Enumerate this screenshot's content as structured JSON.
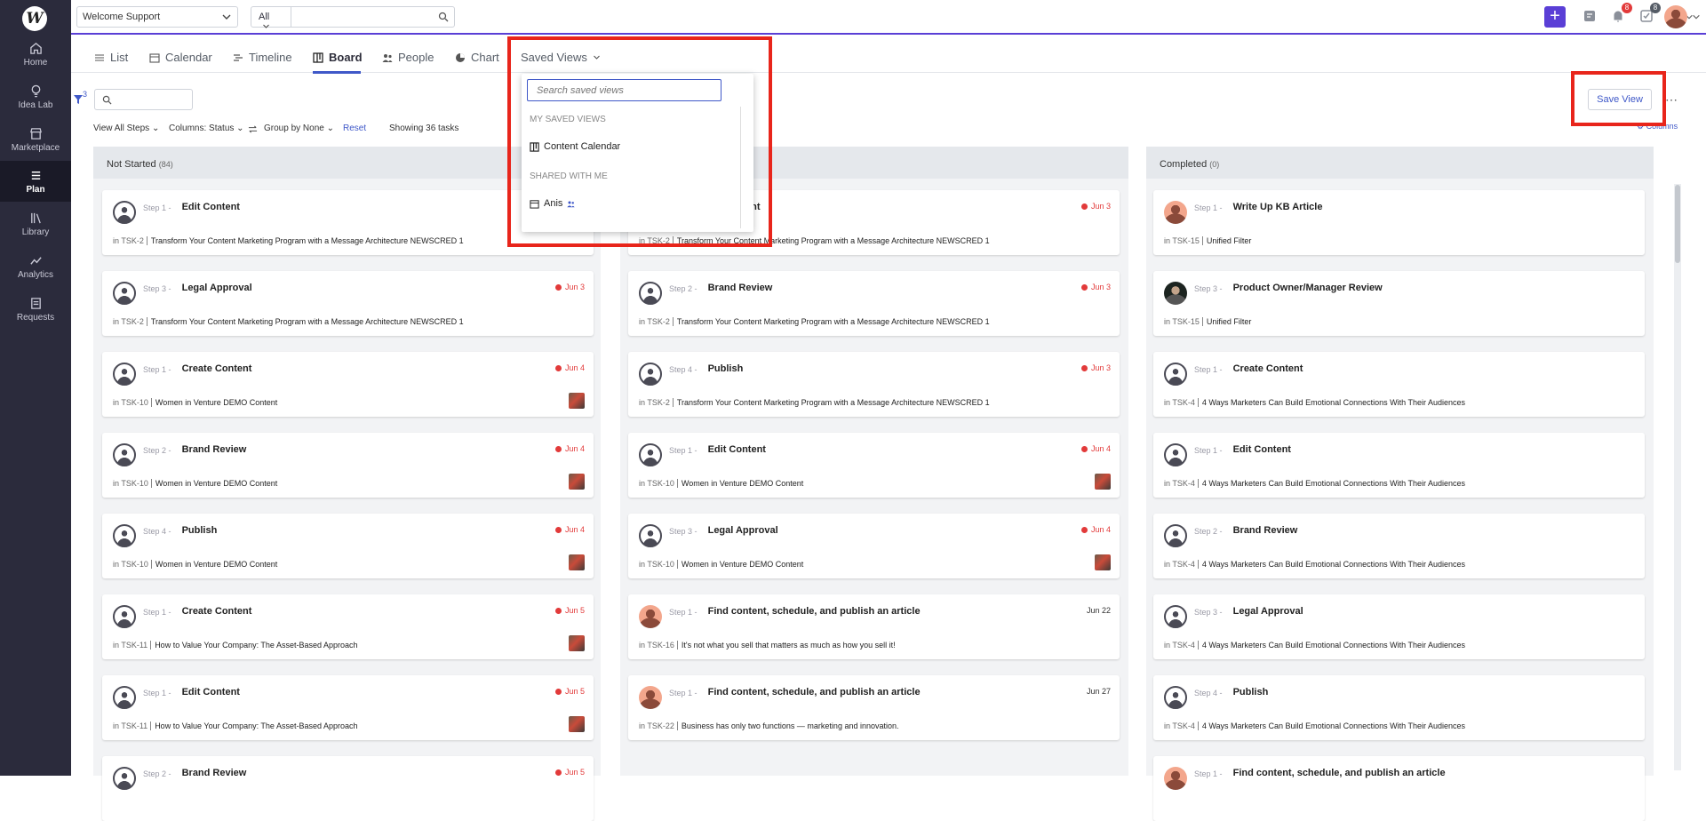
{
  "app": {
    "logo": "W",
    "workspace": "Welcome Support",
    "filter_select": "All",
    "search_placeholder": ""
  },
  "notifications": {
    "bell_count": "8",
    "tasks_count": "8"
  },
  "sidebar": {
    "items": [
      {
        "label": "Home"
      },
      {
        "label": "Idea Lab"
      },
      {
        "label": "Marketplace"
      },
      {
        "label": "Plan"
      },
      {
        "label": "Library"
      },
      {
        "label": "Analytics"
      },
      {
        "label": "Requests"
      }
    ]
  },
  "tabs": [
    "List",
    "Calendar",
    "Timeline",
    "Board",
    "People",
    "Chart",
    "Saved Views"
  ],
  "active_tab": "Board",
  "toolbar": {
    "filter_count": "3",
    "view_steps": "View All Steps",
    "columns": "Columns:",
    "columns_value": "Status",
    "group_by": "Group by",
    "group_value": "None",
    "reset": "Reset",
    "showing": "Showing 36 tasks",
    "save_view": "Save View",
    "columns_link": "Columns"
  },
  "saved_views": {
    "search_placeholder": "Search saved views",
    "my_section": "MY SAVED VIEWS",
    "my_item": "Content Calendar",
    "shared_section": "SHARED WITH ME",
    "shared_item": "Anis"
  },
  "columns": [
    {
      "name": "Not Started",
      "count": "(84)",
      "cards": [
        {
          "step": "Step 1 -",
          "title": "Edit Content",
          "due": "",
          "task": "TSK-2",
          "project": "Transform Your Content Marketing Program with a Message Architecture NEWSCRED 1",
          "thumb": false
        },
        {
          "step": "Step 3 -",
          "title": "Legal Approval",
          "due": "Jun 3",
          "task": "TSK-2",
          "project": "Transform Your Content Marketing Program with a Message Architecture NEWSCRED 1",
          "thumb": false
        },
        {
          "step": "Step 1 -",
          "title": "Create Content",
          "due": "Jun 4",
          "task": "TSK-10",
          "project": "Women in Venture DEMO Content",
          "thumb": true
        },
        {
          "step": "Step 2 -",
          "title": "Brand Review",
          "due": "Jun 4",
          "task": "TSK-10",
          "project": "Women in Venture DEMO Content",
          "thumb": true
        },
        {
          "step": "Step 4 -",
          "title": "Publish",
          "due": "Jun 4",
          "task": "TSK-10",
          "project": "Women in Venture DEMO Content",
          "thumb": true
        },
        {
          "step": "Step 1 -",
          "title": "Create Content",
          "due": "Jun 5",
          "task": "TSK-11",
          "project": "How to Value Your Company: The Asset-Based Approach",
          "thumb": true
        },
        {
          "step": "Step 1 -",
          "title": "Edit Content",
          "due": "Jun 5",
          "task": "TSK-11",
          "project": "How to Value Your Company: The Asset-Based Approach",
          "thumb": true
        },
        {
          "step": "Step 2 -",
          "title": "Brand Review",
          "due": "Jun 5",
          "task": "",
          "project": "",
          "thumb": false
        }
      ]
    },
    {
      "name": "",
      "count": "",
      "cards": [
        {
          "step": "",
          "title": "ent",
          "due": "Jun 3",
          "task": "TSK-2",
          "project": "Transform Your Content Marketing Program with a Message Architecture NEWSCRED 1",
          "thumb": false
        },
        {
          "step": "Step 2 -",
          "title": "Brand Review",
          "due": "Jun 3",
          "task": "TSK-2",
          "project": "Transform Your Content Marketing Program with a Message Architecture NEWSCRED 1",
          "thumb": false
        },
        {
          "step": "Step 4 -",
          "title": "Publish",
          "due": "Jun 3",
          "task": "TSK-2",
          "project": "Transform Your Content Marketing Program with a Message Architecture NEWSCRED 1",
          "thumb": false
        },
        {
          "step": "Step 1 -",
          "title": "Edit Content",
          "due": "Jun 4",
          "task": "TSK-10",
          "project": "Women in Venture DEMO Content",
          "thumb": true
        },
        {
          "step": "Step 3 -",
          "title": "Legal Approval",
          "due": "Jun 4",
          "task": "TSK-10",
          "project": "Women in Venture DEMO Content",
          "thumb": true
        },
        {
          "step": "Step 1 -",
          "title": "Find content, schedule, and publish an article",
          "due": "Jun 22",
          "task": "TSK-16",
          "project": "It's not what you sell that matters as much as how you sell it!",
          "thumb": false
        },
        {
          "step": "Step 1 -",
          "title": "Find content, schedule, and publish an article",
          "due": "Jun 27",
          "task": "TSK-22",
          "project": "Business has only two functions — marketing and innovation.",
          "thumb": false
        }
      ]
    },
    {
      "name": "Completed",
      "count": "(0)",
      "cards": [
        {
          "step": "Step 1 -",
          "title": "Write Up KB Article",
          "due": "",
          "task": "TSK-15",
          "project": "Unified Filter",
          "thumb": false
        },
        {
          "step": "Step 3 -",
          "title": "Product Owner/Manager Review",
          "due": "",
          "task": "TSK-15",
          "project": "Unified Filter",
          "thumb": false
        },
        {
          "step": "Step 1 -",
          "title": "Create Content",
          "due": "",
          "task": "TSK-4",
          "project": "4 Ways Marketers Can Build Emotional Connections With Their Audiences",
          "thumb": false
        },
        {
          "step": "Step 1 -",
          "title": "Edit Content",
          "due": "",
          "task": "TSK-4",
          "project": "4 Ways Marketers Can Build Emotional Connections With Their Audiences",
          "thumb": false
        },
        {
          "step": "Step 2 -",
          "title": "Brand Review",
          "due": "",
          "task": "TSK-4",
          "project": "4 Ways Marketers Can Build Emotional Connections With Their Audiences",
          "thumb": false
        },
        {
          "step": "Step 3 -",
          "title": "Legal Approval",
          "due": "",
          "task": "TSK-4",
          "project": "4 Ways Marketers Can Build Emotional Connections With Their Audiences",
          "thumb": false
        },
        {
          "step": "Step 4 -",
          "title": "Publish",
          "due": "",
          "task": "TSK-4",
          "project": "4 Ways Marketers Can Build Emotional Connections With Their Audiences",
          "thumb": false
        },
        {
          "step": "Step 1 -",
          "title": "Find content, schedule, and publish an article",
          "due": "",
          "task": "",
          "project": "",
          "thumb": false
        }
      ]
    }
  ],
  "in_label": "in",
  "colors": {
    "accent": "#5a3fd6",
    "link": "#3f58c8",
    "due_red": "#e23a3a",
    "highlight": "#e8251b"
  }
}
